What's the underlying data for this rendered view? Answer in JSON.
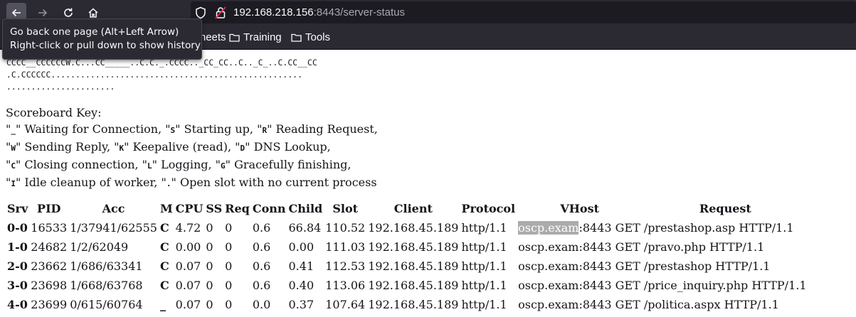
{
  "browser": {
    "url_host": "192.168.218.156",
    "url_port": ":8443",
    "url_path": "/server-status",
    "bookmarks": [
      "heat sheets",
      "Training",
      "Tools"
    ],
    "tooltip": {
      "line1": "Go back one page (Alt+Left Arrow)",
      "line2": "Right-click or pull down to show history"
    }
  },
  "scoreboard": {
    "lines": [
      "CCCC__CCCCCCW.C...CC_____..C.C._.CCCC.._CC_CC..C.._C_..C.CC__CC",
      ".C.CCCCCC...................................................",
      "......................"
    ]
  },
  "key": {
    "title": "Scoreboard Key:",
    "l1": [
      {
        "t": "\""
      },
      {
        "c": "_"
      },
      {
        "t": "\" Waiting for Connection, \""
      },
      {
        "c": "S"
      },
      {
        "t": "\" Starting up, \""
      },
      {
        "c": "R"
      },
      {
        "t": "\" Reading Request,"
      }
    ],
    "l2": [
      {
        "t": "\""
      },
      {
        "c": "W"
      },
      {
        "t": "\" Sending Reply, \""
      },
      {
        "c": "K"
      },
      {
        "t": "\" Keepalive (read), \""
      },
      {
        "c": "D"
      },
      {
        "t": "\" DNS Lookup,"
      }
    ],
    "l3": [
      {
        "t": "\""
      },
      {
        "c": "C"
      },
      {
        "t": "\" Closing connection, \""
      },
      {
        "c": "L"
      },
      {
        "t": "\" Logging, \""
      },
      {
        "c": "G"
      },
      {
        "t": "\" Gracefully finishing,"
      }
    ],
    "l4": [
      {
        "t": "\""
      },
      {
        "c": "I"
      },
      {
        "t": "\" Idle cleanup of worker, \""
      },
      {
        "c": "."
      },
      {
        "t": "\" Open slot with no current process"
      }
    ]
  },
  "table": {
    "headers": [
      "Srv",
      "PID",
      "Acc",
      "M",
      "CPU",
      "SS",
      "Req",
      "Conn",
      "Child",
      "Slot",
      "Client",
      "Protocol",
      "VHost",
      "Request"
    ],
    "rows": [
      [
        "0-0",
        "16533",
        "1/37941/62555",
        "C",
        "4.72",
        "0",
        "0",
        "0.6",
        "66.84",
        "110.52",
        "192.168.45.189",
        "http/1.1",
        "oscp.exam",
        ":8443 GET /prestashop.asp HTTP/1.1"
      ],
      [
        "1-0",
        "24682",
        "1/2/62049",
        "C",
        "0.00",
        "0",
        "0",
        "0.6",
        "0.00",
        "111.03",
        "192.168.45.189",
        "http/1.1",
        "oscp.exam",
        ":8443 GET /pravo.php HTTP/1.1"
      ],
      [
        "2-0",
        "23662",
        "1/686/63341",
        "C",
        "0.07",
        "0",
        "0",
        "0.6",
        "0.41",
        "112.53",
        "192.168.45.189",
        "http/1.1",
        "oscp.exam",
        ":8443 GET /prestashop HTTP/1.1"
      ],
      [
        "3-0",
        "23698",
        "1/668/63768",
        "C",
        "0.07",
        "0",
        "0",
        "0.6",
        "0.40",
        "113.06",
        "192.168.45.189",
        "http/1.1",
        "oscp.exam",
        ":8443 GET /price_inquiry.php HTTP/1.1"
      ],
      [
        "4-0",
        "23699",
        "0/615/60764",
        "_",
        "0.07",
        "0",
        "0",
        "0.0",
        "0.37",
        "107.64",
        "192.168.45.189",
        "http/1.1",
        "oscp.exam",
        ":8443 GET /politica.aspx HTTP/1.1"
      ]
    ],
    "highlighted_row": 0
  }
}
